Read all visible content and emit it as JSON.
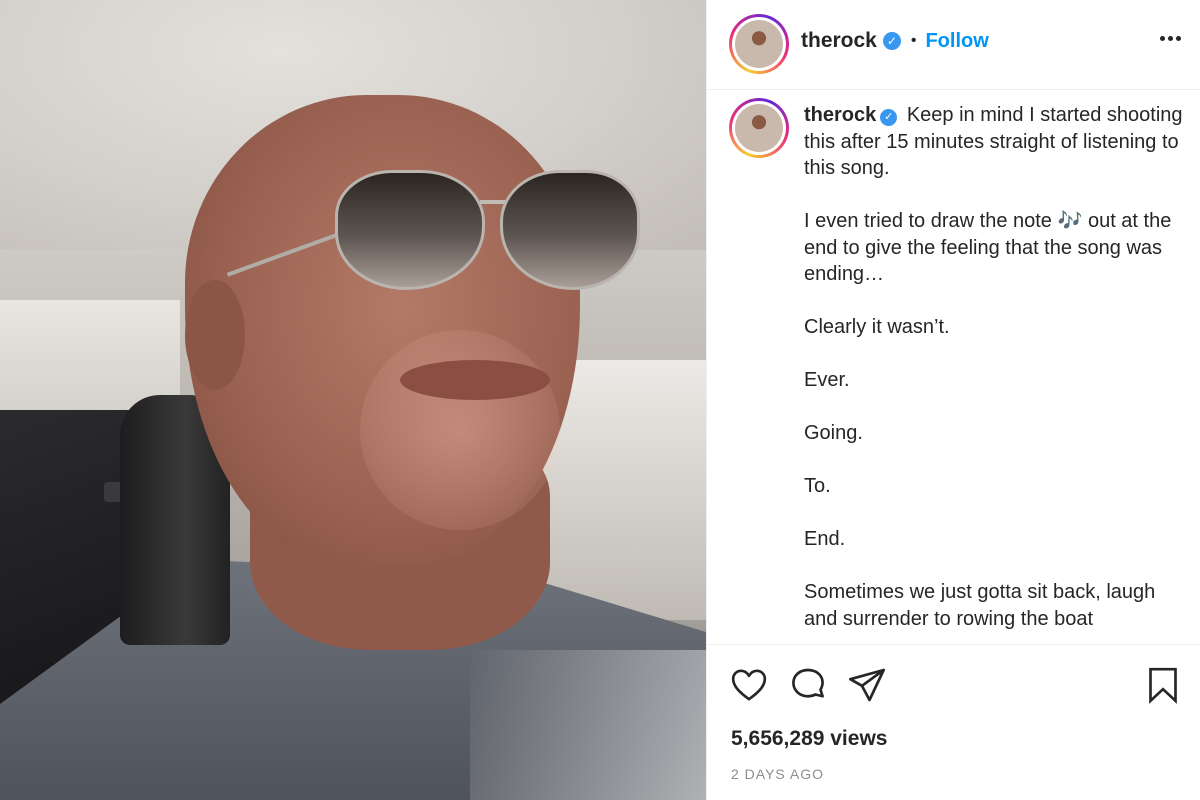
{
  "header": {
    "username": "therock",
    "verified_mark": "✓",
    "separator": "•",
    "follow_label": "Follow"
  },
  "caption": {
    "username": "therock",
    "paragraphs": [
      "Keep in mind I started shooting this after 15 minutes straight of listening to this song.",
      "I even tried to draw the note 🎶 out at the end to give the feeling that the song was ending…",
      "Clearly it wasn’t.",
      "Ever.",
      "Going.",
      "To.",
      "End.",
      "Sometimes we just gotta sit back, laugh and surrender to rowing the boat"
    ]
  },
  "actions": {
    "icons": [
      "heart-icon",
      "comment-icon",
      "share-icon",
      "bookmark-icon"
    ],
    "views": "5,656,289 views",
    "age": "2 DAYS AGO"
  },
  "colors": {
    "accent": "#0095f6",
    "verified": "#3897f0",
    "text": "#262626",
    "muted": "#8e8e8e",
    "border": "#efefef"
  }
}
